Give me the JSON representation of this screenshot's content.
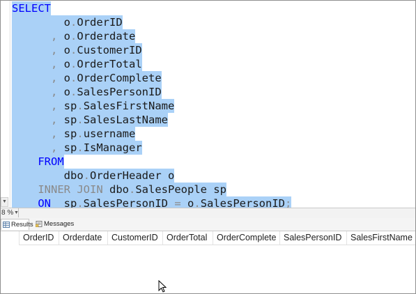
{
  "editor": {
    "lines": [
      [
        {
          "t": "SELECT",
          "c": "kw"
        }
      ],
      [
        {
          "t": "        o",
          "c": "tx"
        },
        {
          "t": ".",
          "c": "gr"
        },
        {
          "t": "OrderID",
          "c": "tx"
        }
      ],
      [
        {
          "t": "      ",
          "c": "tx"
        },
        {
          "t": ",",
          "c": "gr"
        },
        {
          "t": " o",
          "c": "tx"
        },
        {
          "t": ".",
          "c": "gr"
        },
        {
          "t": "Orderdate",
          "c": "tx"
        }
      ],
      [
        {
          "t": "      ",
          "c": "tx"
        },
        {
          "t": ",",
          "c": "gr"
        },
        {
          "t": " o",
          "c": "tx"
        },
        {
          "t": ".",
          "c": "gr"
        },
        {
          "t": "CustomerID",
          "c": "tx"
        }
      ],
      [
        {
          "t": "      ",
          "c": "tx"
        },
        {
          "t": ",",
          "c": "gr"
        },
        {
          "t": " o",
          "c": "tx"
        },
        {
          "t": ".",
          "c": "gr"
        },
        {
          "t": "OrderTotal",
          "c": "tx"
        }
      ],
      [
        {
          "t": "      ",
          "c": "tx"
        },
        {
          "t": ",",
          "c": "gr"
        },
        {
          "t": " o",
          "c": "tx"
        },
        {
          "t": ".",
          "c": "gr"
        },
        {
          "t": "OrderComplete",
          "c": "tx"
        }
      ],
      [
        {
          "t": "      ",
          "c": "tx"
        },
        {
          "t": ",",
          "c": "gr"
        },
        {
          "t": " o",
          "c": "tx"
        },
        {
          "t": ".",
          "c": "gr"
        },
        {
          "t": "SalesPersonID",
          "c": "tx"
        }
      ],
      [
        {
          "t": "      ",
          "c": "tx"
        },
        {
          "t": ",",
          "c": "gr"
        },
        {
          "t": " sp",
          "c": "tx"
        },
        {
          "t": ".",
          "c": "gr"
        },
        {
          "t": "SalesFirstName",
          "c": "tx"
        }
      ],
      [
        {
          "t": "      ",
          "c": "tx"
        },
        {
          "t": ",",
          "c": "gr"
        },
        {
          "t": " sp",
          "c": "tx"
        },
        {
          "t": ".",
          "c": "gr"
        },
        {
          "t": "SalesLastName",
          "c": "tx"
        }
      ],
      [
        {
          "t": "      ",
          "c": "tx"
        },
        {
          "t": ",",
          "c": "gr"
        },
        {
          "t": " sp",
          "c": "tx"
        },
        {
          "t": ".",
          "c": "gr"
        },
        {
          "t": "username",
          "c": "tx"
        }
      ],
      [
        {
          "t": "      ",
          "c": "tx"
        },
        {
          "t": ",",
          "c": "gr"
        },
        {
          "t": " sp",
          "c": "tx"
        },
        {
          "t": ".",
          "c": "gr"
        },
        {
          "t": "IsManager",
          "c": "tx"
        }
      ],
      [
        {
          "t": "    ",
          "c": "tx"
        },
        {
          "t": "FROM",
          "c": "kw"
        }
      ],
      [
        {
          "t": "        dbo",
          "c": "tx"
        },
        {
          "t": ".",
          "c": "gr"
        },
        {
          "t": "OrderHeader o",
          "c": "tx"
        }
      ],
      [
        {
          "t": "    ",
          "c": "tx"
        },
        {
          "t": "INNER JOIN",
          "c": "gr"
        },
        {
          "t": " dbo",
          "c": "tx"
        },
        {
          "t": ".",
          "c": "gr"
        },
        {
          "t": "SalesPeople sp",
          "c": "tx"
        }
      ],
      [
        {
          "t": "    ",
          "c": "tx"
        },
        {
          "t": "ON",
          "c": "kw"
        },
        {
          "t": "  sp",
          "c": "tx"
        },
        {
          "t": ".",
          "c": "gr"
        },
        {
          "t": "SalesPersonID ",
          "c": "tx"
        },
        {
          "t": "=",
          "c": "gr"
        },
        {
          "t": " o",
          "c": "tx"
        },
        {
          "t": ".",
          "c": "gr"
        },
        {
          "t": "SalesPersonID",
          "c": "tx"
        },
        {
          "t": ";",
          "c": "gr"
        }
      ]
    ]
  },
  "statusbar": {
    "zoom": "8 %"
  },
  "tabs": [
    {
      "label": "Results",
      "icon": "grid-icon",
      "active": true
    },
    {
      "label": "Messages",
      "icon": "messages-icon",
      "active": false
    }
  ],
  "grid": {
    "columns": [
      "OrderID",
      "Orderdate",
      "CustomerID",
      "OrderTotal",
      "OrderComplete",
      "SalesPersonID",
      "SalesFirstName"
    ]
  },
  "colors": {
    "selection": "#aad1f7",
    "keyword": "#0000ff",
    "operator": "#8a8a8a"
  }
}
